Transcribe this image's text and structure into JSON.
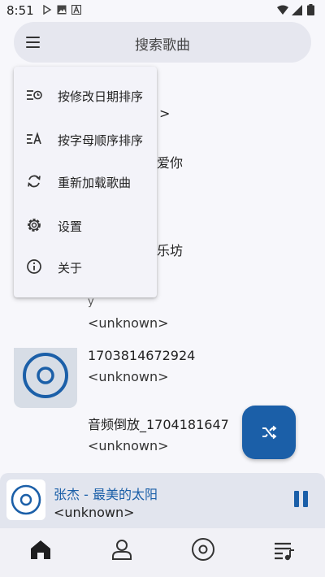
{
  "status_bar": {
    "time": "8:51",
    "icons": [
      "play-store-icon",
      "image-icon",
      "text-a-icon",
      "wifi-icon",
      "signal-icon",
      "battery-icon"
    ]
  },
  "search": {
    "placeholder": "搜索歌曲"
  },
  "menu": {
    "items": [
      {
        "label": "按修改日期排序",
        "icon": "sort-by-date-icon"
      },
      {
        "label": "按字母顺序排序",
        "icon": "sort-alpha-icon"
      },
      {
        "label": "重新加载歌曲",
        "icon": "reload-icon"
      },
      {
        "label": "设置",
        "icon": "gear-icon"
      },
      {
        "label": "关于",
        "icon": "info-icon"
      }
    ]
  },
  "song_list": {
    "partial_fragments": [
      ">",
      "爱你",
      "乐坊"
    ],
    "items": [
      {
        "title": "",
        "artist": "<unknown>"
      },
      {
        "title": "1703814672924",
        "artist": "<unknown>"
      },
      {
        "title": "音频倒放_1704181647",
        "artist": "<unknown>"
      }
    ]
  },
  "mini_player": {
    "title": "张杰 - 最美的太阳",
    "artist": "<unknown>"
  },
  "bottom_nav": {
    "items": [
      "home-icon",
      "person-icon",
      "disc-icon",
      "playlist-icon"
    ]
  },
  "colors": {
    "accent": "#1b5fa8",
    "background": "#f7f7fb",
    "search_bg": "#e6e7ef",
    "menu_bg": "#f3f3f9",
    "player_bg": "#e2e5ee"
  }
}
